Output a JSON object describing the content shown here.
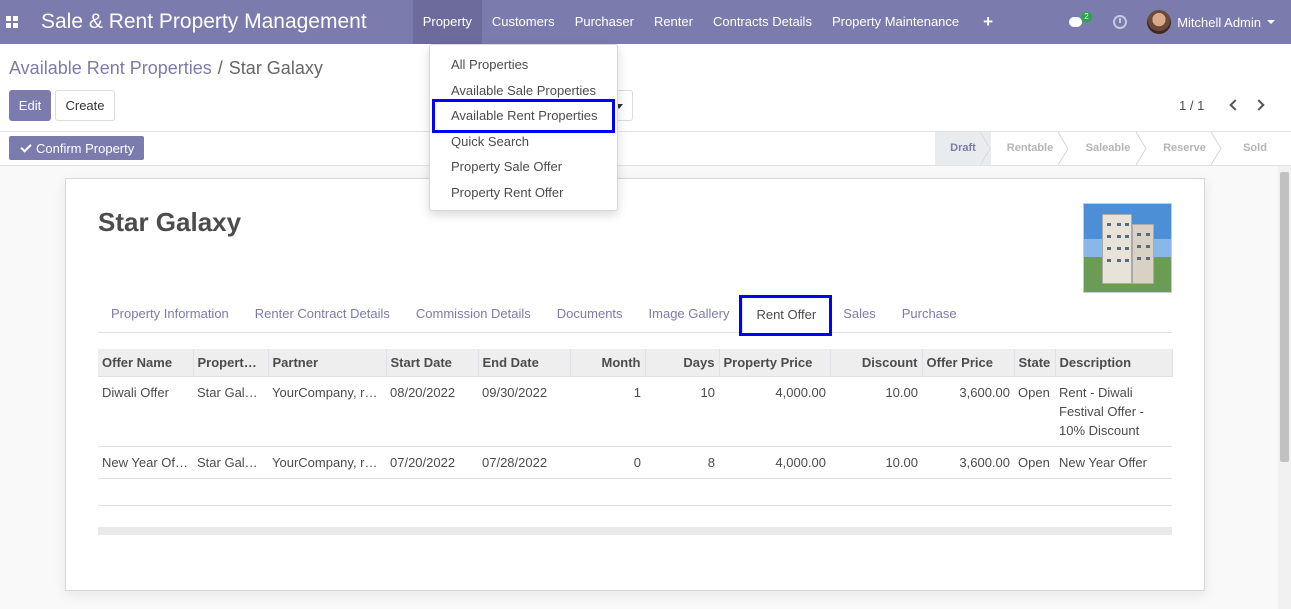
{
  "navbar": {
    "brand": "Sale & Rent Property Management",
    "menu": [
      "Property",
      "Customers",
      "Purchaser",
      "Renter",
      "Contracts Details",
      "Property Maintenance"
    ],
    "chat_badge": "2",
    "user_name": "Mitchell Admin"
  },
  "dropdown": {
    "items": [
      "All Properties",
      "Available Sale Properties",
      "Available Rent Properties",
      "Quick Search",
      "Property Sale Offer",
      "Property Rent Offer"
    ],
    "highlighted": "Available Rent Properties"
  },
  "breadcrumb": {
    "parent": "Available Rent Properties",
    "separator": "/",
    "current": "Star Galaxy"
  },
  "buttons": {
    "edit": "Edit",
    "create": "Create",
    "confirm": "Confirm Property"
  },
  "pager": {
    "value": "1 / 1"
  },
  "stages": {
    "items": [
      "Draft",
      "Rentable",
      "Saleable",
      "Reserve",
      "Sold"
    ],
    "current": "Draft"
  },
  "record": {
    "title": "Star Galaxy",
    "image": "building-photo"
  },
  "tabs": {
    "items": [
      "Property Information",
      "Renter Contract Details",
      "Commission Details",
      "Documents",
      "Image Gallery",
      "Rent Offer",
      "Sales",
      "Purchase"
    ],
    "active": "Rent Offer"
  },
  "table": {
    "columns": [
      "Offer Name",
      "Property…",
      "Partner",
      "Start Date",
      "End Date",
      "Month",
      "Days",
      "Property Price",
      "Discount",
      "Offer Price",
      "State",
      "Description"
    ],
    "rows": [
      [
        "Diwali Offer",
        "Star Gal…",
        "YourCompany, r…",
        "08/20/2022",
        "09/30/2022",
        "1",
        "10",
        "4,000.00",
        "10.00",
        "3,600.00",
        "Open",
        "Rent - Diwali Festival Offer - 10% Discount"
      ],
      [
        "New Year Of…",
        "Star Gal…",
        "YourCompany, r…",
        "07/20/2022",
        "07/28/2022",
        "0",
        "8",
        "4,000.00",
        "10.00",
        "3,600.00",
        "Open",
        "New Year Offer"
      ]
    ]
  },
  "colors": {
    "primary": "#7c7bad",
    "highlight_box": "#0000ff"
  }
}
